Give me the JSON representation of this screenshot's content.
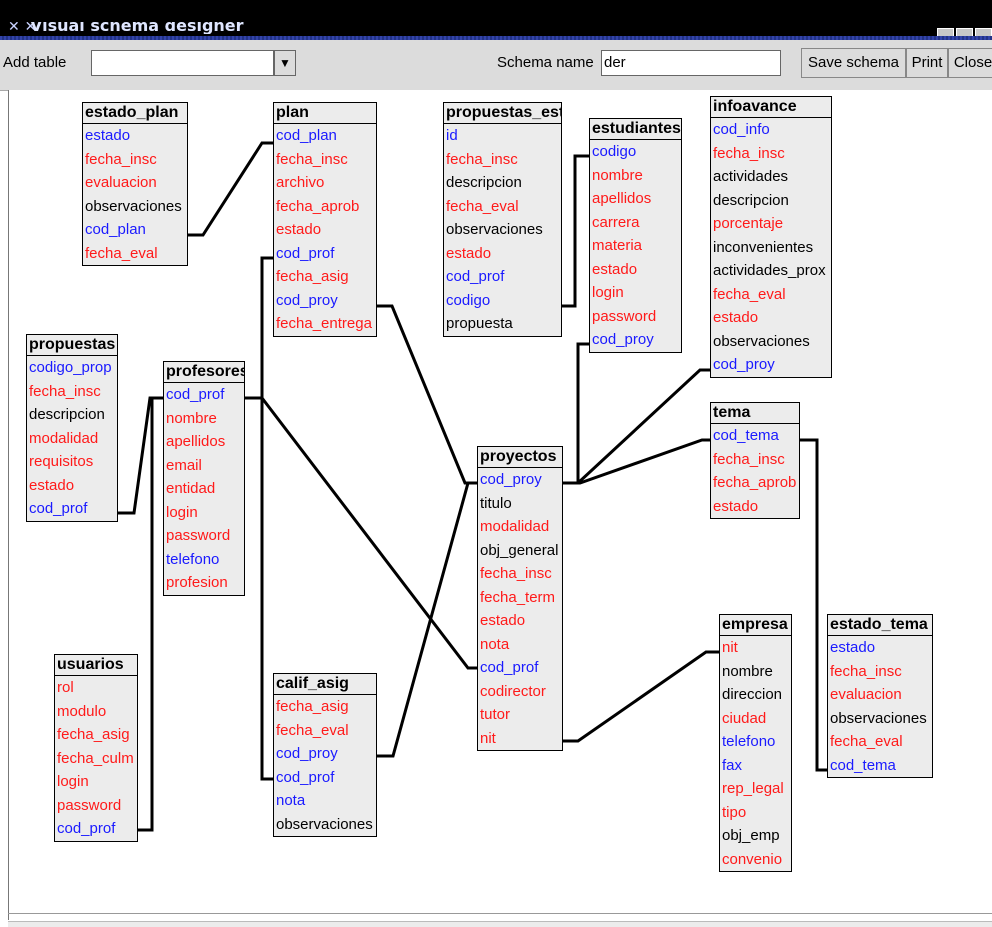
{
  "window": {
    "title": "Visual schema designer"
  },
  "toolbar": {
    "add_table_label": "Add table",
    "add_table_value": "",
    "schema_name_label": "Schema name",
    "schema_name_value": "der",
    "save_label": "Save schema",
    "print_label": "Print",
    "close_label": "Close"
  },
  "colors": {
    "key": "#1a1aff",
    "foreign": "#ff1a1a",
    "plain": "#000000",
    "table_bg": "#ececec"
  },
  "tables": [
    {
      "name": "estado_plan",
      "fields": [
        [
          "estado",
          "pk"
        ],
        [
          "fecha_insc",
          "fk"
        ],
        [
          "evaluacion",
          "fk"
        ],
        [
          "observaciones",
          "plain"
        ],
        [
          "cod_plan",
          "pk"
        ],
        [
          "fecha_eval",
          "fk"
        ]
      ]
    },
    {
      "name": "plan",
      "fields": [
        [
          "cod_plan",
          "pk"
        ],
        [
          "fecha_insc",
          "fk"
        ],
        [
          "archivo",
          "fk"
        ],
        [
          "fecha_aprob",
          "fk"
        ],
        [
          "estado",
          "fk"
        ],
        [
          "cod_prof",
          "pk"
        ],
        [
          "fecha_asig",
          "fk"
        ],
        [
          "cod_proy",
          "pk"
        ],
        [
          "fecha_entrega",
          "fk"
        ]
      ]
    },
    {
      "name": "propuestas_est",
      "fields": [
        [
          "id",
          "pk"
        ],
        [
          "fecha_insc",
          "fk"
        ],
        [
          "descripcion",
          "plain"
        ],
        [
          "fecha_eval",
          "fk"
        ],
        [
          "observaciones",
          "plain"
        ],
        [
          "estado",
          "fk"
        ],
        [
          "cod_prof",
          "pk"
        ],
        [
          "codigo",
          "pk"
        ],
        [
          "propuesta",
          "plain"
        ]
      ]
    },
    {
      "name": "estudiantes",
      "fields": [
        [
          "codigo",
          "pk"
        ],
        [
          "nombre",
          "fk"
        ],
        [
          "apellidos",
          "fk"
        ],
        [
          "carrera",
          "fk"
        ],
        [
          "materia",
          "fk"
        ],
        [
          "estado",
          "fk"
        ],
        [
          "login",
          "fk"
        ],
        [
          "password",
          "fk"
        ],
        [
          "cod_proy",
          "pk"
        ]
      ]
    },
    {
      "name": "infoavance",
      "fields": [
        [
          "cod_info",
          "pk"
        ],
        [
          "fecha_insc",
          "fk"
        ],
        [
          "actividades",
          "plain"
        ],
        [
          "descripcion",
          "plain"
        ],
        [
          "porcentaje",
          "fk"
        ],
        [
          "inconvenientes",
          "plain"
        ],
        [
          "actividades_prox",
          "plain"
        ],
        [
          "fecha_eval",
          "fk"
        ],
        [
          "estado",
          "fk"
        ],
        [
          "observaciones",
          "plain"
        ],
        [
          "cod_proy",
          "pk"
        ]
      ]
    },
    {
      "name": "propuestas",
      "fields": [
        [
          "codigo_prop",
          "pk"
        ],
        [
          "fecha_insc",
          "fk"
        ],
        [
          "descripcion",
          "plain"
        ],
        [
          "modalidad",
          "fk"
        ],
        [
          "requisitos",
          "fk"
        ],
        [
          "estado",
          "fk"
        ],
        [
          "cod_prof",
          "pk"
        ]
      ]
    },
    {
      "name": "profesores",
      "fields": [
        [
          "cod_prof",
          "pk"
        ],
        [
          "nombre",
          "fk"
        ],
        [
          "apellidos",
          "fk"
        ],
        [
          "email",
          "fk"
        ],
        [
          "entidad",
          "fk"
        ],
        [
          "login",
          "fk"
        ],
        [
          "password",
          "fk"
        ],
        [
          "telefono",
          "pk"
        ],
        [
          "profesion",
          "fk"
        ]
      ]
    },
    {
      "name": "tema",
      "fields": [
        [
          "cod_tema",
          "pk"
        ],
        [
          "fecha_insc",
          "fk"
        ],
        [
          "fecha_aprob",
          "fk"
        ],
        [
          "estado",
          "fk"
        ]
      ]
    },
    {
      "name": "proyectos",
      "fields": [
        [
          "cod_proy",
          "pk"
        ],
        [
          "titulo",
          "plain"
        ],
        [
          "modalidad",
          "fk"
        ],
        [
          "obj_general",
          "plain"
        ],
        [
          "fecha_insc",
          "fk"
        ],
        [
          "fecha_term",
          "fk"
        ],
        [
          "estado",
          "fk"
        ],
        [
          "nota",
          "fk"
        ],
        [
          "cod_prof",
          "pk"
        ],
        [
          "codirector",
          "fk"
        ],
        [
          "tutor",
          "fk"
        ],
        [
          "nit",
          "fk"
        ]
      ]
    },
    {
      "name": "empresa",
      "fields": [
        [
          "nit",
          "fk"
        ],
        [
          "nombre",
          "plain"
        ],
        [
          "direccion",
          "plain"
        ],
        [
          "ciudad",
          "fk"
        ],
        [
          "telefono",
          "pk"
        ],
        [
          "fax",
          "pk"
        ],
        [
          "rep_legal",
          "fk"
        ],
        [
          "tipo",
          "fk"
        ],
        [
          "obj_emp",
          "plain"
        ],
        [
          "convenio",
          "fk"
        ]
      ]
    },
    {
      "name": "estado_tema",
      "fields": [
        [
          "estado",
          "pk"
        ],
        [
          "fecha_insc",
          "fk"
        ],
        [
          "evaluacion",
          "fk"
        ],
        [
          "observaciones",
          "plain"
        ],
        [
          "fecha_eval",
          "fk"
        ],
        [
          "cod_tema",
          "pk"
        ]
      ]
    },
    {
      "name": "usuarios",
      "fields": [
        [
          "rol",
          "fk"
        ],
        [
          "modulo",
          "fk"
        ],
        [
          "fecha_asig",
          "fk"
        ],
        [
          "fecha_culm",
          "fk"
        ],
        [
          "login",
          "fk"
        ],
        [
          "password",
          "fk"
        ],
        [
          "cod_prof",
          "pk"
        ]
      ]
    },
    {
      "name": "calif_asig",
      "fields": [
        [
          "fecha_asig",
          "fk"
        ],
        [
          "fecha_eval",
          "fk"
        ],
        [
          "cod_proy",
          "pk"
        ],
        [
          "cod_prof",
          "pk"
        ],
        [
          "nota",
          "pk"
        ],
        [
          "observaciones",
          "plain"
        ]
      ]
    }
  ]
}
